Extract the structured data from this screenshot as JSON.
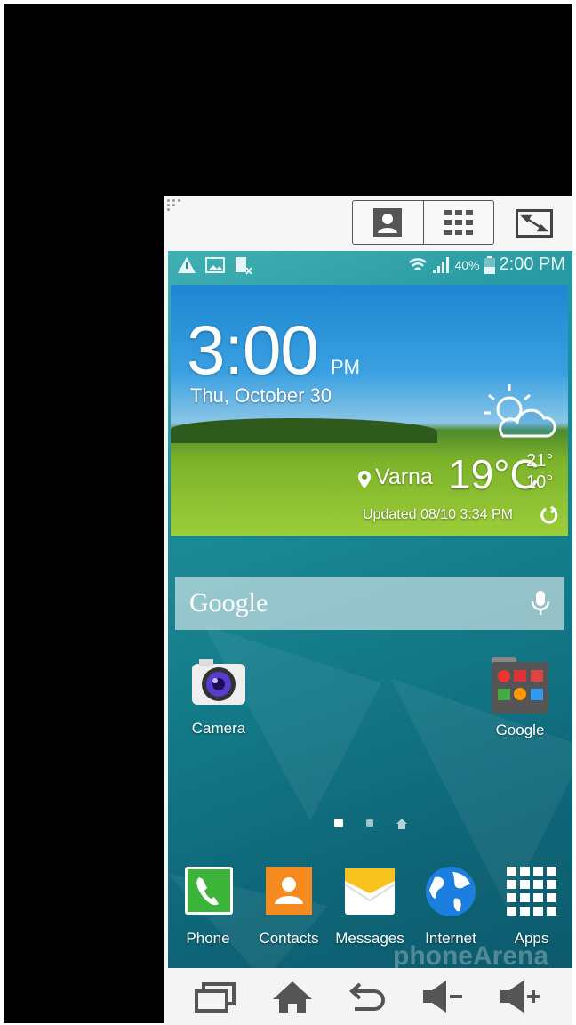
{
  "toolbar": {
    "buttons": [
      {
        "icon": "contacts-person-icon"
      },
      {
        "icon": "grid-apps-icon"
      },
      {
        "icon": "fullscreen-icon"
      }
    ]
  },
  "status_bar": {
    "left_icons": [
      "warning-icon",
      "image-icon",
      "no-sim-icon"
    ],
    "battery": "40%",
    "time": "2:00 PM"
  },
  "widget": {
    "time": "3:00",
    "ampm": "PM",
    "date": "Thu, October 30",
    "location": "Varna",
    "temperature": "19°C",
    "high": "21°",
    "low": "10°",
    "updated": "Updated 08/10 3:34 PM",
    "weather": "partly-cloudy"
  },
  "search": {
    "logo": "Google"
  },
  "home_apps": [
    {
      "label": "Camera"
    },
    {
      "label": "Google"
    }
  ],
  "page_indicator": {
    "pages": 3,
    "current": 1
  },
  "dock": [
    {
      "label": "Phone"
    },
    {
      "label": "Contacts"
    },
    {
      "label": "Messages"
    },
    {
      "label": "Internet"
    },
    {
      "label": "Apps"
    }
  ],
  "nav": [
    "recent-apps",
    "home",
    "back",
    "volume-down",
    "volume-up"
  ],
  "watermark": "phoneArena"
}
